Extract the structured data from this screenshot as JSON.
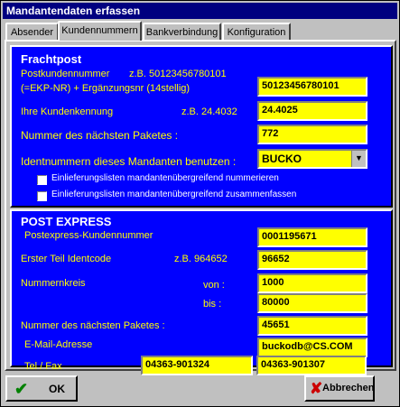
{
  "window": {
    "title": "Mandantendaten erfassen"
  },
  "tabs": [
    {
      "label": "Absender"
    },
    {
      "label": "Kundennummern"
    },
    {
      "label": "Bankverbindung"
    },
    {
      "label": "Konfiguration"
    }
  ],
  "frachtpost": {
    "heading": "Frachtpost",
    "postkunden_label_1": "Postkundennummer",
    "postkunden_example": "z.B. 50123456780101",
    "postkunden_label_2": "(=EKP-NR) + Ergänzungsnr (14stellig)",
    "postkunden_value": "50123456780101",
    "kundenkennung_label": "Ihre Kundenkennung",
    "kundenkennung_example": "z.B. 24.4032",
    "kundenkennung_value": "24.4025",
    "naechstes_paket_label": "Nummer des nächsten Paketes :",
    "naechstes_paket_value": "772",
    "identnummern_label": "Identnummern dieses Mandanten benutzen :",
    "identnummern_value": "BUCKO",
    "checkbox_1_label": "Einlieferungslisten mandantenübergreifend nummerieren",
    "checkbox_1_checked": false,
    "checkbox_2_label": "Einlieferungslisten mandantenübergreifend zusammenfassen",
    "checkbox_2_checked": false
  },
  "postexpress": {
    "heading": "POST EXPRESS",
    "kundennummer_label": "Postexpress-Kundennummer",
    "kundennummer_value": "0001195671",
    "identcode_label": "Erster Teil Identcode",
    "identcode_example": "z.B. 964652",
    "identcode_value": "96652",
    "nummernkreis_label": "Nummernkreis",
    "von_label": "von :",
    "von_value": "1000",
    "bis_label": "bis :",
    "bis_value": "80000",
    "naechstes_paket_label": "Nummer des nächsten Paketes :",
    "naechstes_paket_value": "45651",
    "email_label": "E-Mail-Adresse",
    "email_value": "buckodb@CS.COM",
    "telfax_label": "Tel / Fax",
    "tel_value": "04363-901324",
    "fax_value": "04363-901307"
  },
  "buttons": {
    "ok_label": "OK",
    "cancel_label": "Abbrechen"
  },
  "colors": {
    "panel_blue": "#0000ff",
    "field_yellow": "#ffff00",
    "title_blue": "#000080",
    "ok_green": "#008000",
    "cancel_red": "#cc0000"
  }
}
